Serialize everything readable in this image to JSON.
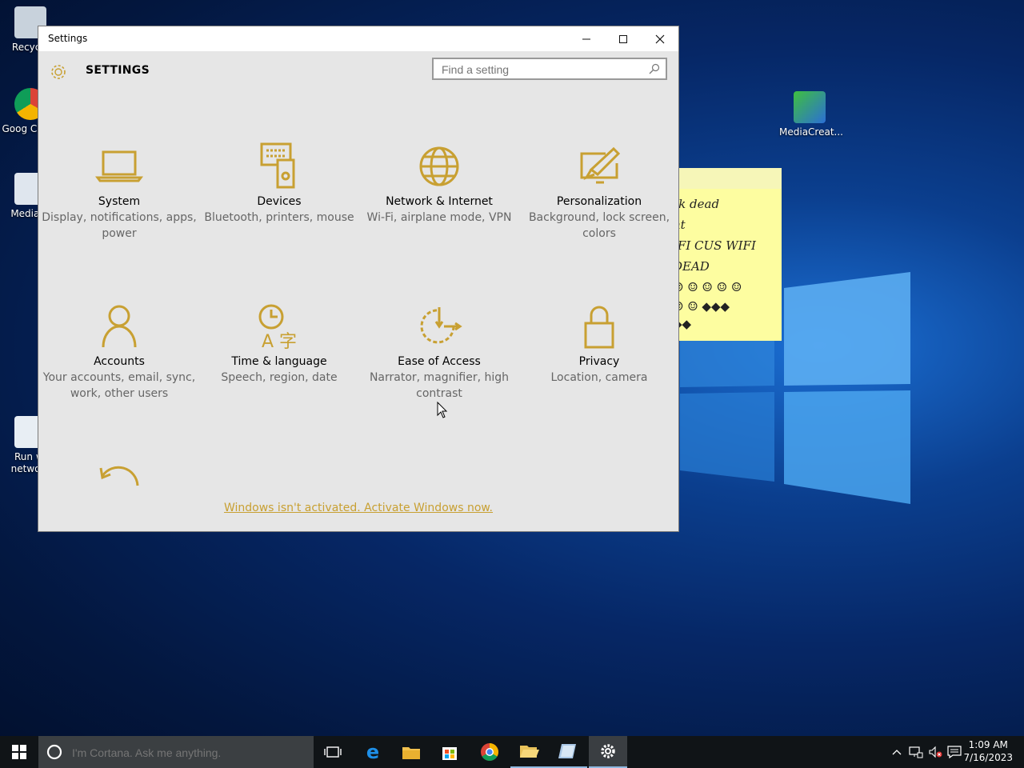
{
  "desktop": {
    "icons": [
      {
        "label": "Recycle"
      },
      {
        "label": "Goog Chron"
      },
      {
        "label": "MediaCr"
      },
      {
        "label": "Run wi network"
      },
      {
        "label": "MediaCreat..."
      }
    ],
    "sticky_lines": [
      "rk dead",
      "nt",
      "IFI CUS WIFI",
      "DEAD",
      "☺ ☺ ☺ ☺ ☺",
      "☺ ☺ ◆◆◆",
      "◆◆"
    ]
  },
  "window": {
    "title": "Settings",
    "minimize": "—",
    "maximize": "☐",
    "close": "✕",
    "heading": "SETTINGS",
    "search_placeholder": "Find a setting",
    "accent": "#c8a032",
    "tiles": [
      {
        "name": "System",
        "desc": "Display, notifications, apps, power",
        "icon": "laptop-icon"
      },
      {
        "name": "Devices",
        "desc": "Bluetooth, printers, mouse",
        "icon": "devices-icon"
      },
      {
        "name": "Network & Internet",
        "desc": "Wi-Fi, airplane mode, VPN",
        "icon": "globe-icon"
      },
      {
        "name": "Personalization",
        "desc": "Background, lock screen, colors",
        "icon": "paint-icon"
      },
      {
        "name": "Accounts",
        "desc": "Your accounts, email, sync, work, other users",
        "icon": "person-icon"
      },
      {
        "name": "Time & language",
        "desc": "Speech, region, date",
        "icon": "time-language-icon"
      },
      {
        "name": "Ease of Access",
        "desc": "Narrator, magnifier, high contrast",
        "icon": "ease-icon"
      },
      {
        "name": "Privacy",
        "desc": "Location, camera",
        "icon": "lock-icon"
      }
    ],
    "activation_link": "Windows isn't activated. Activate Windows now."
  },
  "taskbar": {
    "cortana_placeholder": "I'm Cortana. Ask me anything.",
    "time": "1:09 AM",
    "date": "7/16/2023"
  }
}
